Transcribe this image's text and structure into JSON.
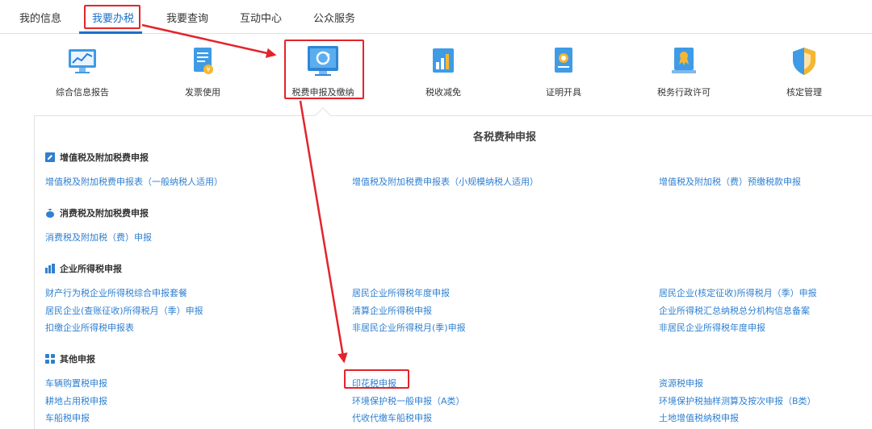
{
  "nav": {
    "tabs": [
      "我的信息",
      "我要办税",
      "我要查询",
      "互动中心",
      "公众服务"
    ],
    "active": "我要办税"
  },
  "functions": [
    {
      "label": "综合信息报告",
      "icon": "monitor-chart-icon"
    },
    {
      "label": "发票使用",
      "icon": "invoice-doc-icon"
    },
    {
      "label": "税费申报及缴纳",
      "icon": "monitor-refresh-icon"
    },
    {
      "label": "税收减免",
      "icon": "bar-chart-doc-icon"
    },
    {
      "label": "证明开具",
      "icon": "certificate-doc-icon"
    },
    {
      "label": "税务行政许可",
      "icon": "license-badge-icon"
    },
    {
      "label": "核定管理",
      "icon": "shield-icon"
    }
  ],
  "panel": {
    "title": "各税费种申报",
    "sections": [
      {
        "title": "增值税及附加税费申报",
        "icon": "edit-square-icon",
        "links": [
          "增值税及附加税费申报表（一般纳税人适用）",
          "增值税及附加税费申报表（小规模纳税人适用）",
          "增值税及附加税（费）预缴税款申报"
        ]
      },
      {
        "title": "消费税及附加税费申报",
        "icon": "money-bag-icon",
        "links": [
          "消费税及附加税（费）申报"
        ]
      },
      {
        "title": "企业所得税申报",
        "icon": "building-chart-icon",
        "links": [
          "财产行为税企业所得税综合申报套餐",
          "居民企业所得税年度申报",
          "居民企业(核定征收)所得税月（季）申报",
          "居民企业(查账征收)所得税月（季）申报",
          "清算企业所得税申报",
          "企业所得税汇总纳税总分机构信息备案",
          "扣缴企业所得税申报表",
          "非居民企业所得税月(季)申报",
          "非居民企业所得税年度申报"
        ]
      },
      {
        "title": "其他申报",
        "icon": "grid-squares-icon",
        "links": [
          "车辆购置税申报",
          "印花税申报",
          "资源税申报",
          "耕地占用税申报",
          "环境保护税一般申报（A类）",
          "环境保护税抽样测算及按次申报（B类）",
          "车船税申报",
          "代收代缴车船税申报",
          "土地增值税纳税申报"
        ]
      }
    ]
  },
  "annotation_color": "#e3242b"
}
